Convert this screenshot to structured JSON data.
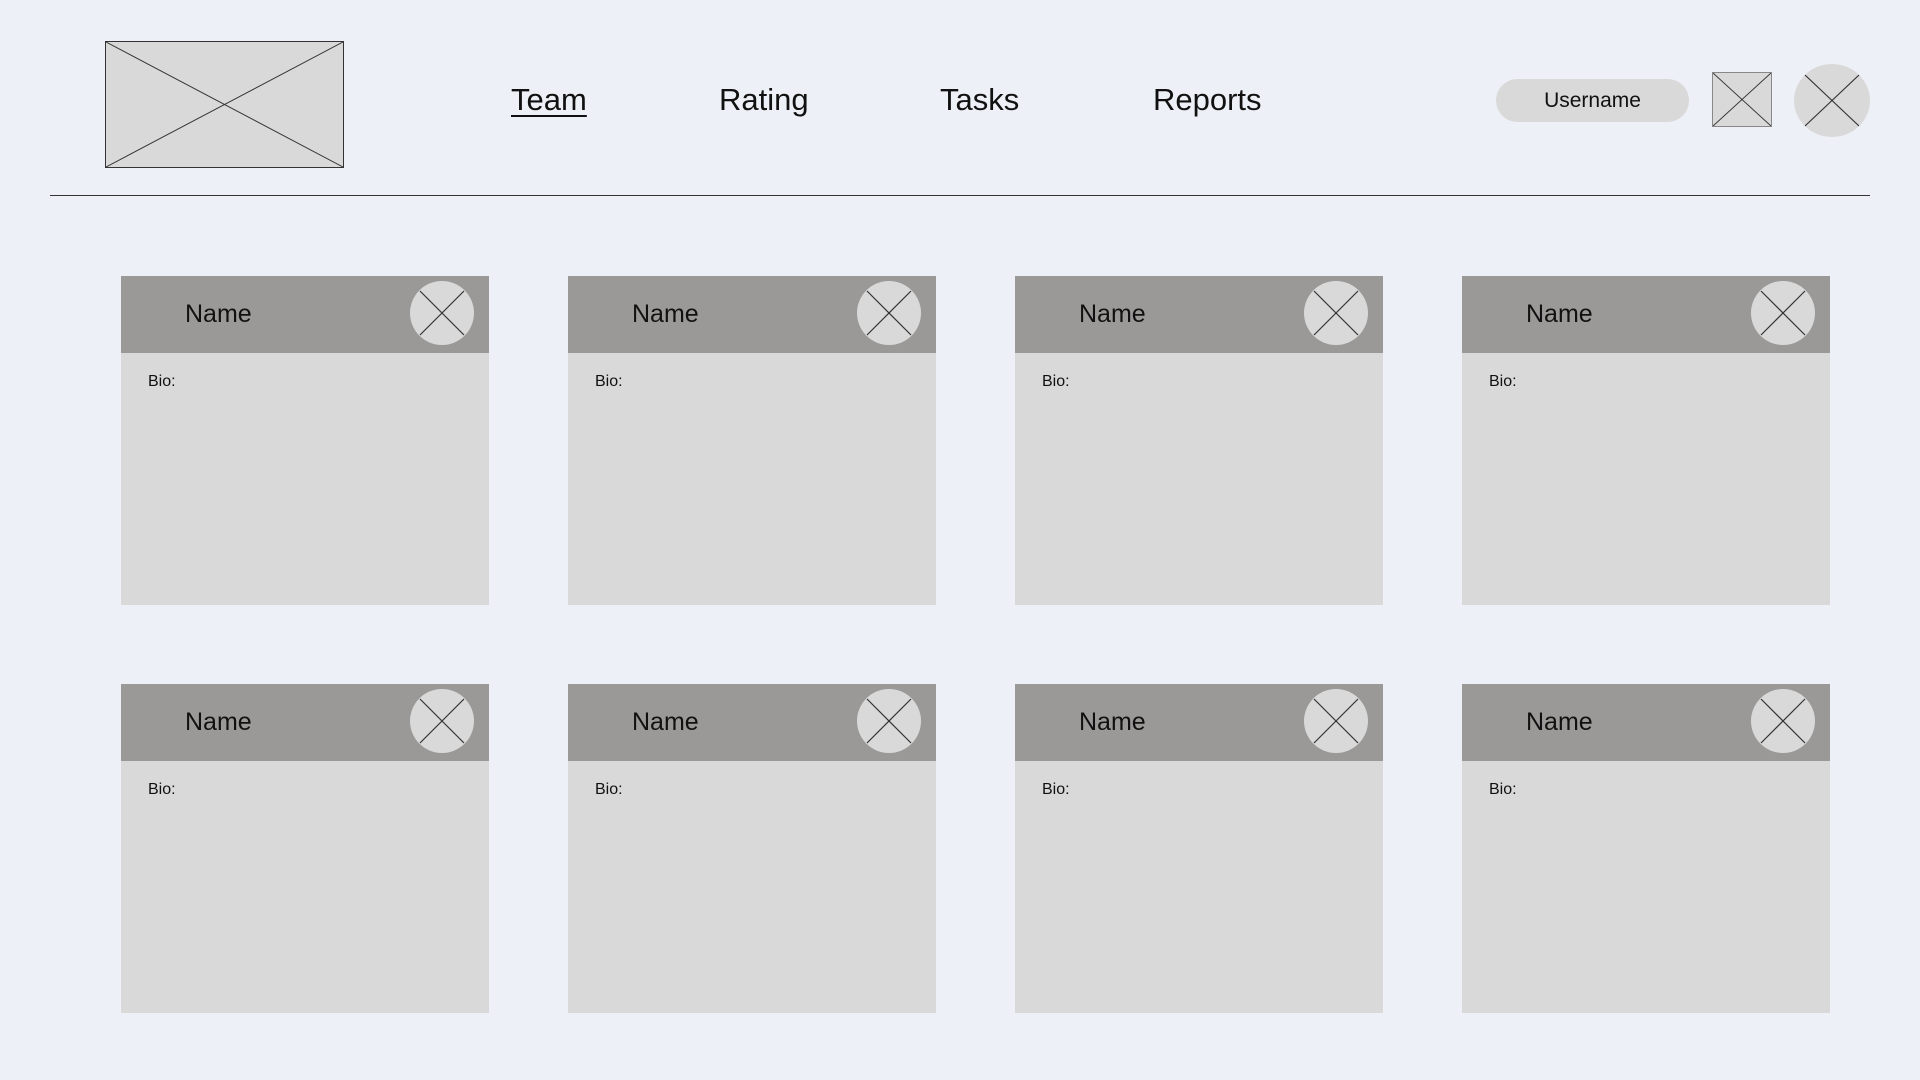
{
  "header": {
    "logo_icon": "image-placeholder-icon",
    "nav": [
      {
        "label": "Team",
        "active": true
      },
      {
        "label": "Rating",
        "active": false
      },
      {
        "label": "Tasks",
        "active": false
      },
      {
        "label": "Reports",
        "active": false
      }
    ],
    "username": "Username",
    "notification_icon": "image-placeholder-icon",
    "avatar_icon": "avatar-placeholder-icon"
  },
  "colors": {
    "background": "#edf0f6",
    "placeholder": "#d9d9d9",
    "card_header": "#9a9998"
  },
  "cards": [
    {
      "name": "Name",
      "bio_label": "Bio:"
    },
    {
      "name": "Name",
      "bio_label": "Bio:"
    },
    {
      "name": "Name",
      "bio_label": "Bio:"
    },
    {
      "name": "Name",
      "bio_label": "Bio:"
    },
    {
      "name": "Name",
      "bio_label": "Bio:"
    },
    {
      "name": "Name",
      "bio_label": "Bio:"
    },
    {
      "name": "Name",
      "bio_label": "Bio:"
    },
    {
      "name": "Name",
      "bio_label": "Bio:"
    }
  ]
}
